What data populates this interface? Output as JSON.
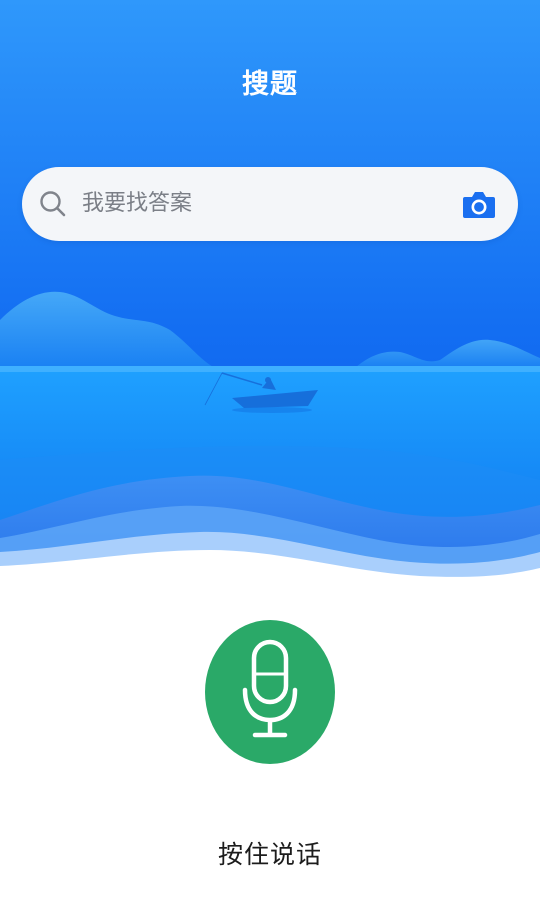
{
  "header": {
    "title": "搜题"
  },
  "search": {
    "placeholder": "我要找答案",
    "search_icon": "search-icon",
    "camera_icon": "camera-icon"
  },
  "voice": {
    "label": "按住说话",
    "mic_icon": "microphone-icon",
    "button_color": "#2aa968"
  },
  "colors": {
    "primary_blue": "#1a7cf2",
    "white": "#ffffff"
  }
}
